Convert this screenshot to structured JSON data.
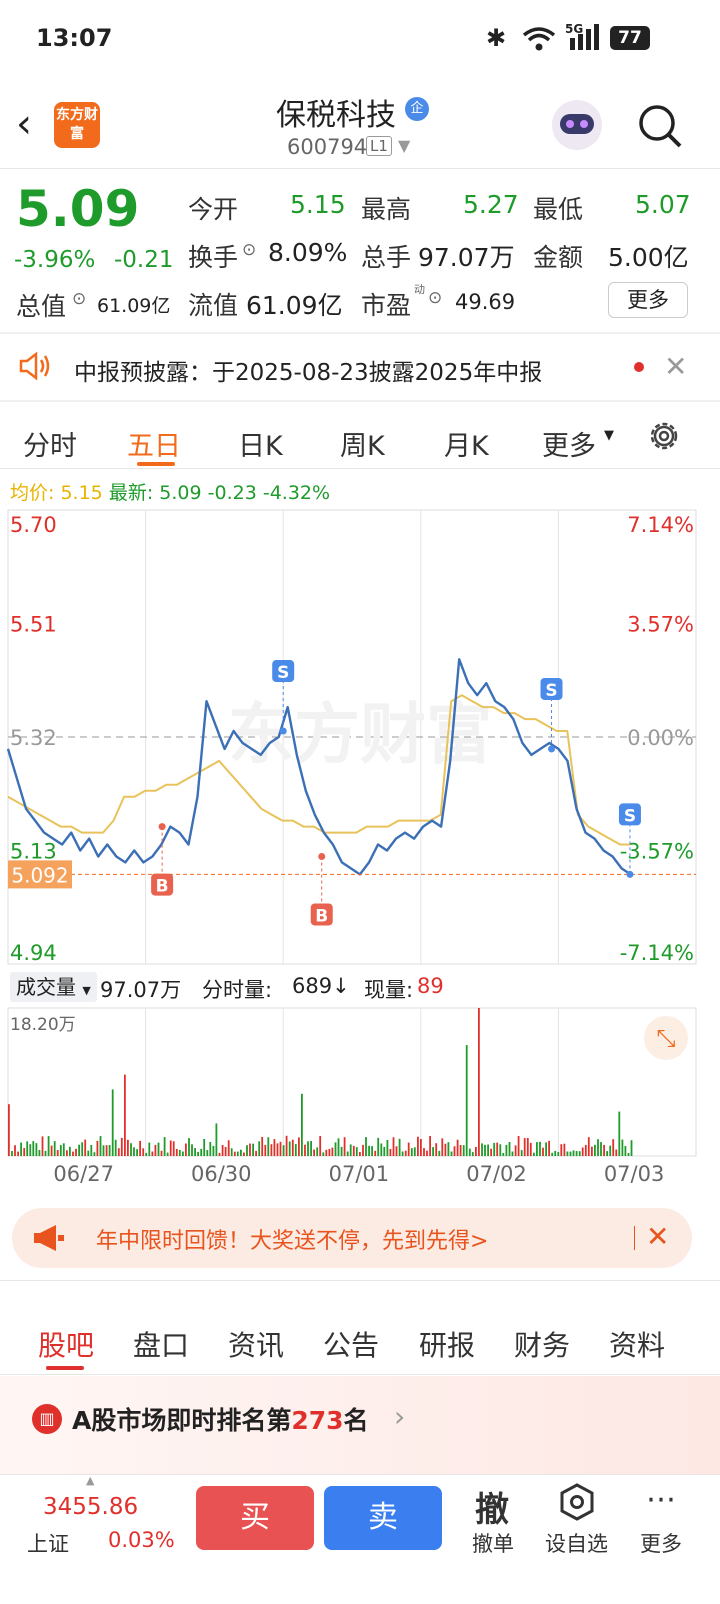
{
  "status_bar": {
    "time": "13:07",
    "battery": "77",
    "signal": "5G"
  },
  "header": {
    "logo_text": "东方财富",
    "stock_name": "保税科技",
    "badge": "企",
    "code": "600794",
    "level": "L1"
  },
  "quote": {
    "price": "5.09",
    "change_pct": "-3.96%",
    "change": "-0.21",
    "open_label": "今开",
    "open": "5.15",
    "high_label": "最高",
    "high": "5.27",
    "low_label": "最低",
    "low": "5.07",
    "turnover_label": "换手",
    "turnover": "8.09%",
    "volume_label": "总手",
    "volume": "97.07万",
    "amount_label": "金额",
    "amount": "5.00亿",
    "mktcap_label": "总值",
    "mktcap": "61.09亿",
    "float_label": "流值",
    "float": "61.09亿",
    "pe_label": "市盈",
    "pe_sup": "动",
    "pe": "49.69",
    "more": "更多"
  },
  "notice": {
    "text": "中报预披露：于2025-08-23披露2025年中报"
  },
  "chart_tabs": [
    "分时",
    "五日",
    "日K",
    "周K",
    "月K",
    "更多"
  ],
  "chart_info": {
    "avg_label": "均价:",
    "avg": "5.15",
    "latest_label": "最新:",
    "latest": "5.09",
    "latest_chg": "-0.23",
    "latest_pct": "-4.32%"
  },
  "watermark": "东方财富",
  "volume_bar": {
    "label": "成交量",
    "total": "97.07万",
    "tick_label": "分时量:",
    "tick": "689↓",
    "now_label": "现量:",
    "now": "89",
    "max": "18.20万"
  },
  "chart_data": {
    "type": "line",
    "title": "",
    "x_labels": [
      "06/27",
      "06/30",
      "07/01",
      "07/02",
      "07/03"
    ],
    "ylim": [
      4.94,
      5.7
    ],
    "y_ticks_left": [
      "5.70",
      "5.51",
      "5.32",
      "5.13",
      "4.94"
    ],
    "y_ticks_right": [
      "7.14%",
      "3.57%",
      "0.00%",
      "-3.57%",
      "-7.14%"
    ],
    "prev_close": 5.32,
    "current_marker": "5.092",
    "series": [
      {
        "name": "price",
        "color": "#3b6fb6",
        "values": [
          5.3,
          5.25,
          5.2,
          5.18,
          5.16,
          5.15,
          5.14,
          5.16,
          5.13,
          5.15,
          5.12,
          5.14,
          5.12,
          5.11,
          5.13,
          5.11,
          5.12,
          5.14,
          5.17,
          5.16,
          5.14,
          5.22,
          5.38,
          5.34,
          5.3,
          5.33,
          5.31,
          5.3,
          5.29,
          5.31,
          5.32,
          5.37,
          5.29,
          5.23,
          5.19,
          5.16,
          5.14,
          5.11,
          5.1,
          5.09,
          5.11,
          5.14,
          5.13,
          5.15,
          5.16,
          5.15,
          5.17,
          5.18,
          5.17,
          5.28,
          5.45,
          5.41,
          5.39,
          5.41,
          5.38,
          5.37,
          5.35,
          5.31,
          5.29,
          5.3,
          5.31,
          5.3,
          5.28,
          5.2,
          5.16,
          5.15,
          5.13,
          5.12,
          5.1,
          5.09
        ]
      },
      {
        "name": "avg",
        "color": "#e8c25a",
        "values": [
          5.22,
          5.21,
          5.2,
          5.19,
          5.18,
          5.17,
          5.17,
          5.16,
          5.16,
          5.16,
          5.18,
          5.22,
          5.22,
          5.23,
          5.23,
          5.24,
          5.24,
          5.25,
          5.26,
          5.27,
          5.28,
          5.26,
          5.24,
          5.22,
          5.2,
          5.19,
          5.18,
          5.18,
          5.17,
          5.17,
          5.16,
          5.16,
          5.16,
          5.16,
          5.17,
          5.17,
          5.17,
          5.18,
          5.18,
          5.18,
          5.18,
          5.19,
          5.38,
          5.39,
          5.38,
          5.37,
          5.37,
          5.36,
          5.36,
          5.35,
          5.35,
          5.34,
          5.33,
          5.33,
          5.19,
          5.17,
          5.16,
          5.15,
          5.14,
          5.14
        ]
      }
    ],
    "markers": [
      {
        "label": "B",
        "x": "06/30",
        "price": 5.17
      },
      {
        "label": "S",
        "x": "07/01",
        "price": 5.33
      },
      {
        "label": "B",
        "x": "07/01",
        "price": 5.12
      },
      {
        "label": "S",
        "x": "07/02",
        "price": 5.3
      },
      {
        "label": "S",
        "x": "07/03",
        "price": 5.09
      }
    ]
  },
  "promo": {
    "text": "年中限时回馈！大奖送不停，先到先得>"
  },
  "bottom_tabs": [
    "股吧",
    "盘口",
    "资讯",
    "公告",
    "研报",
    "财务",
    "资料"
  ],
  "ranking": {
    "prefix": "A股市场即时排名第",
    "rank": "273",
    "suffix": "名"
  },
  "footer": {
    "index_value": "3455.86",
    "index_name": "上证",
    "index_pct": "0.03%",
    "buy": "买",
    "sell": "卖",
    "cancel_glyph": "撤",
    "cancel": "撤单",
    "watch": "设自选",
    "more": "更多"
  }
}
